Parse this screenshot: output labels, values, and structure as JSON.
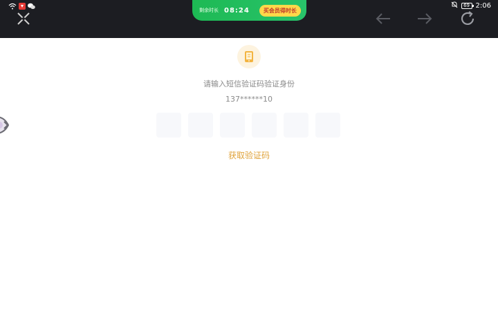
{
  "status_bar": {
    "clock": "2:06",
    "battery": "69"
  },
  "timer": {
    "label": "剩余时长",
    "value": "08:24",
    "vip_button": "买会员得时长"
  },
  "verify": {
    "prompt": "请输入短信验证码验证身份",
    "phone": "137******10",
    "code_boxes": [
      "",
      "",
      "",
      "",
      "",
      ""
    ],
    "get_code_label": "获取验证码"
  },
  "colors": {
    "topbar": "#1c1d22",
    "timer_green": "#1db954",
    "vip_yellow": "#ffd84a",
    "accent_orange": "#e0a33a"
  }
}
